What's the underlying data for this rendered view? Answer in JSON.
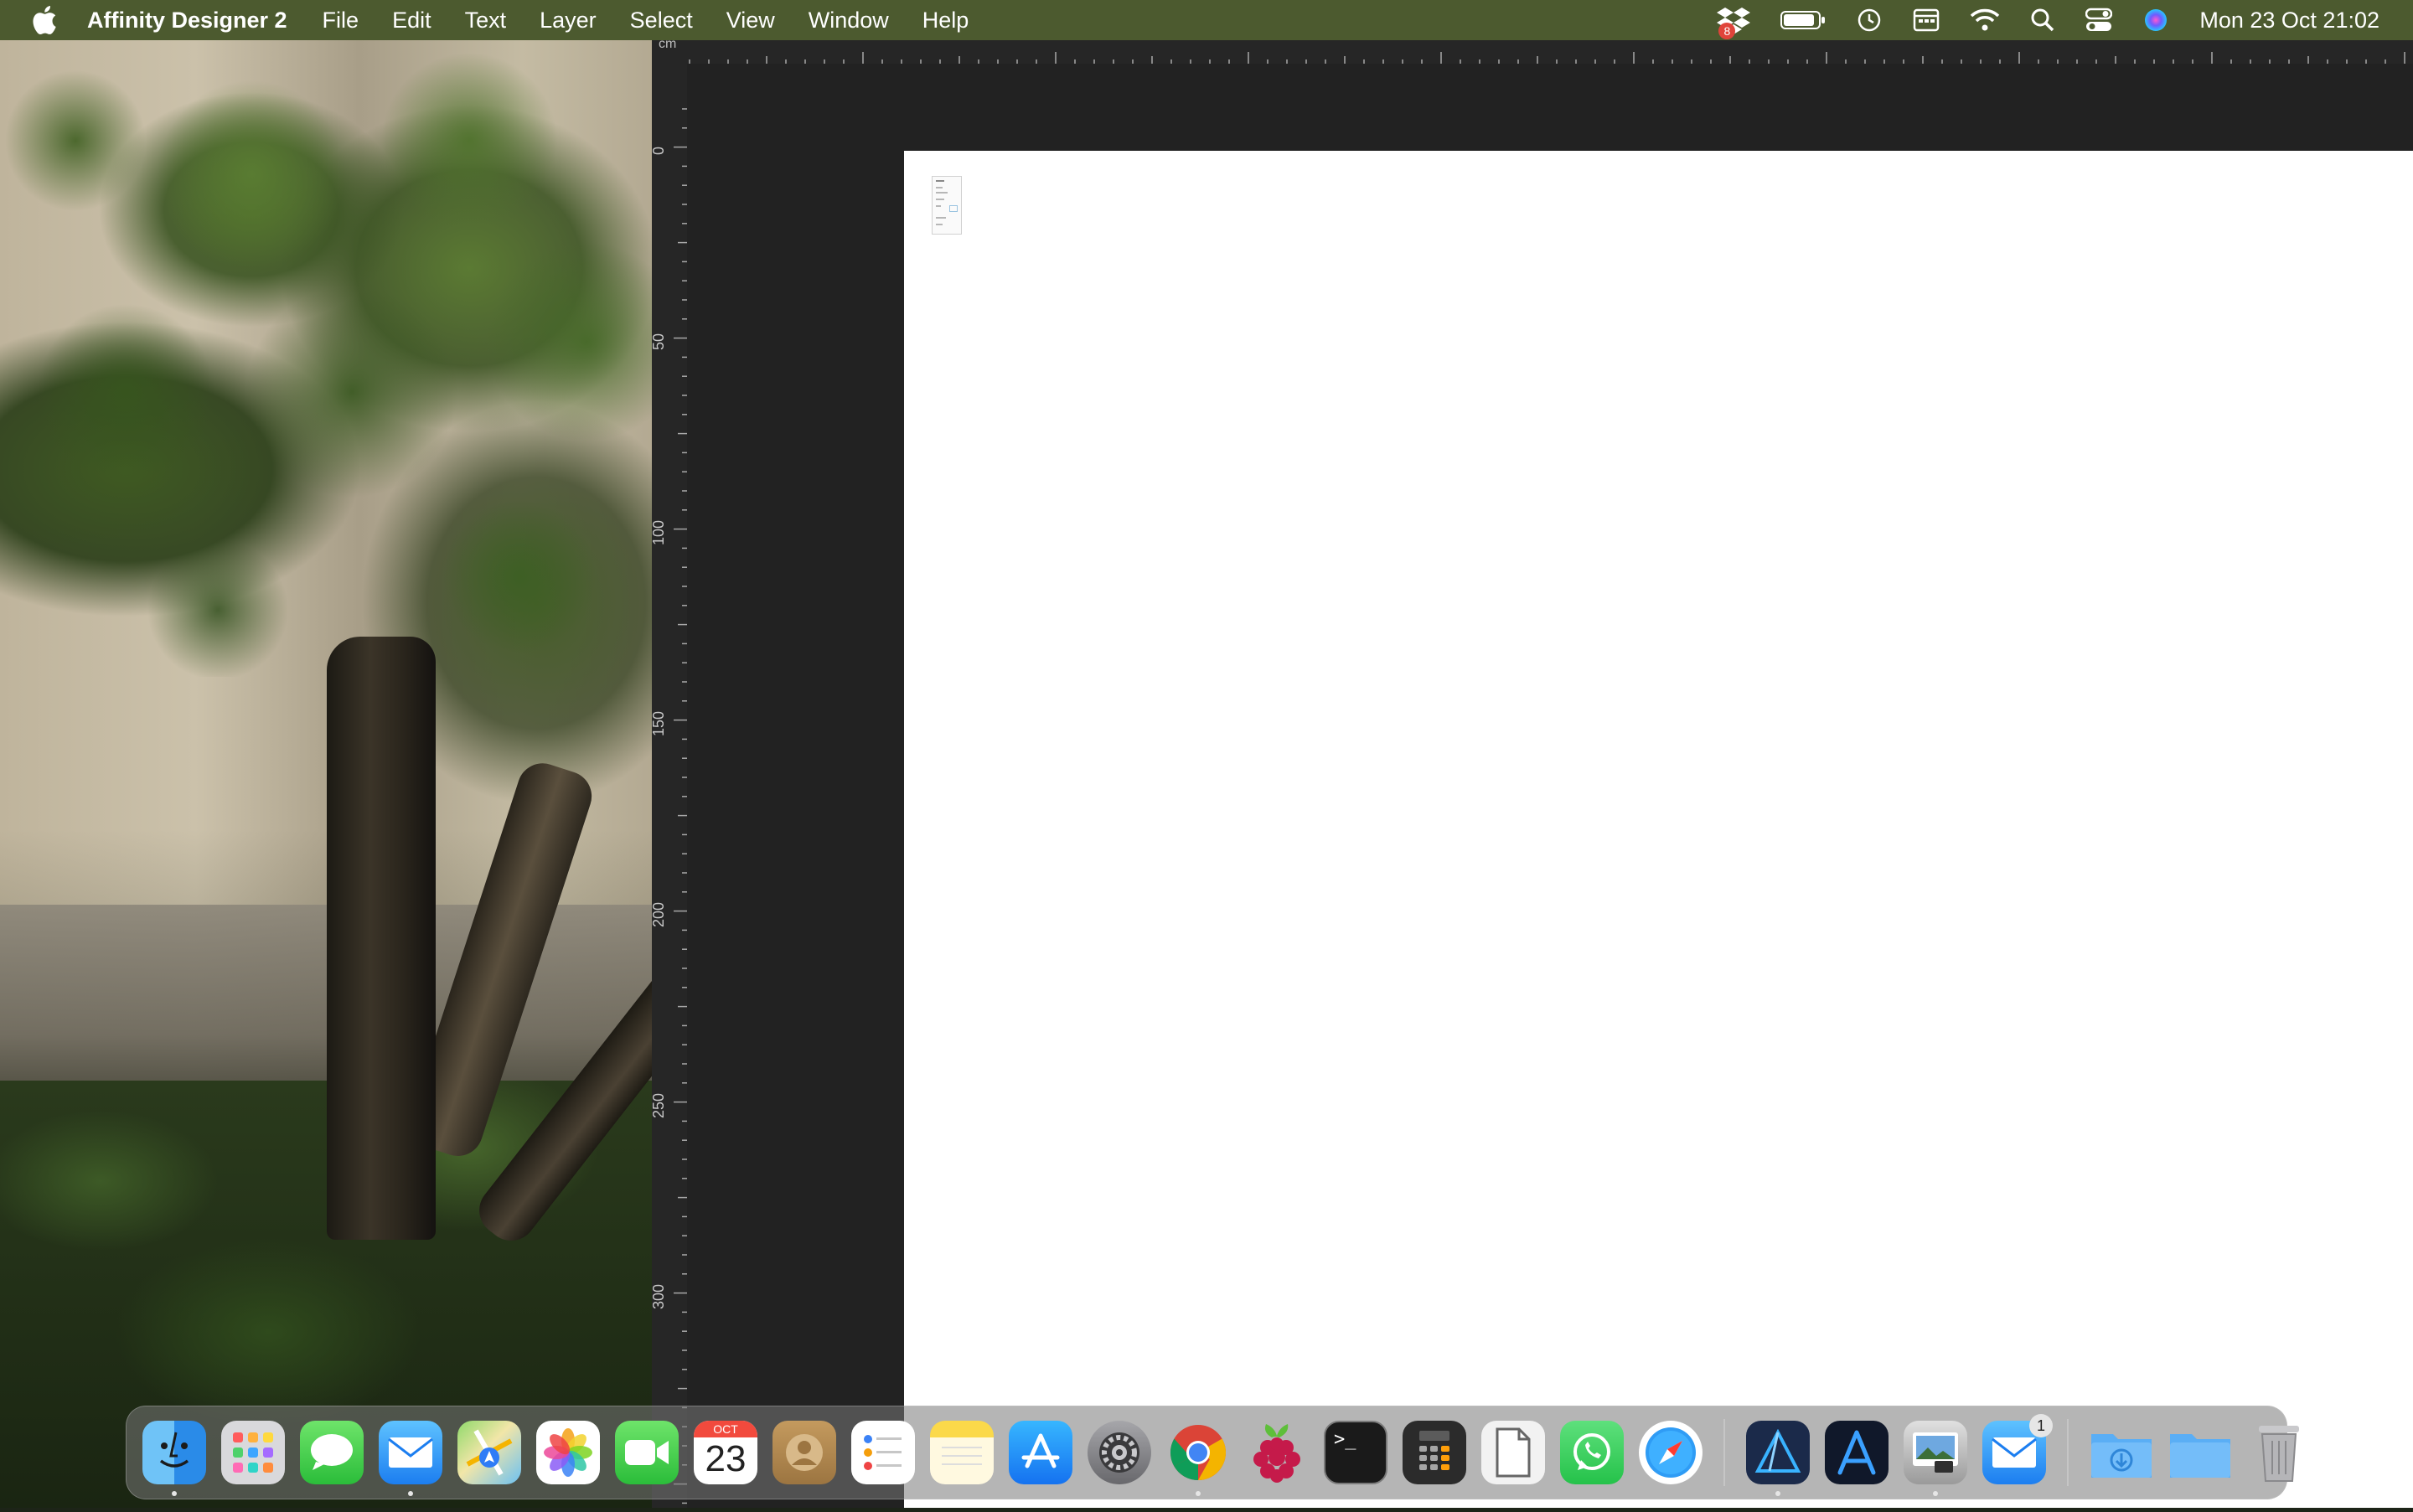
{
  "menubar": {
    "app_name": "Affinity Designer 2",
    "menus": [
      "File",
      "Edit",
      "Text",
      "Layer",
      "Select",
      "View",
      "Window",
      "Help"
    ],
    "clock": "Mon 23 Oct  21:02",
    "dropbox_badge": "8",
    "status_icons": [
      "dropbox-icon",
      "battery-icon",
      "time-machine-icon",
      "calendar-menu-icon",
      "wifi-icon",
      "spotlight-search-icon",
      "control-center-icon",
      "siri-icon"
    ]
  },
  "ruler": {
    "unit": "cm",
    "left_labels": [
      "0",
      "50",
      "100",
      "150",
      "200",
      "250",
      "300"
    ]
  },
  "dock": {
    "calendar_month": "OCT",
    "calendar_day": "23",
    "mail_badge": "1",
    "apps": [
      {
        "name": "finder-icon",
        "running": true
      },
      {
        "name": "launchpad-icon",
        "running": false
      },
      {
        "name": "messages-icon",
        "running": false
      },
      {
        "name": "mail-icon",
        "running": true
      },
      {
        "name": "maps-icon",
        "running": false
      },
      {
        "name": "photos-icon",
        "running": false
      },
      {
        "name": "facetime-icon",
        "running": false
      },
      {
        "name": "calendar-icon",
        "running": false
      },
      {
        "name": "contacts-icon",
        "running": false
      },
      {
        "name": "reminders-icon",
        "running": false
      },
      {
        "name": "notes-icon",
        "running": false
      },
      {
        "name": "app-store-icon",
        "running": false
      },
      {
        "name": "system-settings-icon",
        "running": false
      },
      {
        "name": "chrome-icon",
        "running": true
      },
      {
        "name": "raspberry-pi-icon",
        "running": false
      },
      {
        "name": "terminal-icon",
        "running": false
      },
      {
        "name": "calculator-icon",
        "running": false
      },
      {
        "name": "textedit-icon",
        "running": false
      },
      {
        "name": "whatsapp-icon",
        "running": false
      },
      {
        "name": "safari-icon",
        "running": false
      },
      {
        "name": "affinity-designer-icon",
        "running": true
      },
      {
        "name": "xcode-instruments-icon",
        "running": false
      },
      {
        "name": "preview-icon",
        "running": true
      },
      {
        "name": "mail-notification-icon",
        "running": false
      },
      {
        "name": "downloads-folder-icon",
        "running": false
      },
      {
        "name": "folder-icon",
        "running": false
      },
      {
        "name": "trash-icon",
        "running": false
      }
    ]
  },
  "colors": {
    "menubar": "#4c5a2f",
    "canvas_bg": "#222222",
    "artboard": "#ffffff",
    "ruler_bg": "#262626"
  }
}
